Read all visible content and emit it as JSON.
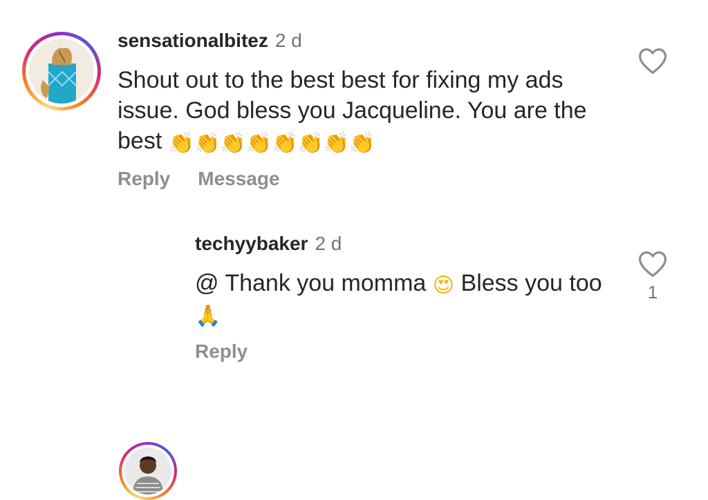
{
  "comments": [
    {
      "username": "sensationalbitez",
      "timestamp": "2 d",
      "text": "Shout out to the best best for fixing my ads issue. God bless you Jacqueline. You are the best",
      "emoji": "👏👏👏👏👏👏👏👏",
      "actions": {
        "reply": "Reply",
        "message": "Message"
      },
      "like_icon": "heart-outline-icon"
    },
    {
      "username": "techyybaker",
      "timestamp": "2 d",
      "text_before": "@ Thank you momma",
      "emoji_1": "😍",
      "text_after": "Bless you too",
      "emoji_2": "🙏",
      "actions": {
        "reply": "Reply"
      },
      "like_icon": "heart-outline-icon",
      "like_count": "1"
    }
  ],
  "colors": {
    "text": "#262626",
    "secondary": "#8e8e8e",
    "timestamp": "#737373",
    "story_ring": [
      "#feda75",
      "#fa7e1e",
      "#d62976",
      "#962fbf",
      "#4f5bd5"
    ]
  }
}
